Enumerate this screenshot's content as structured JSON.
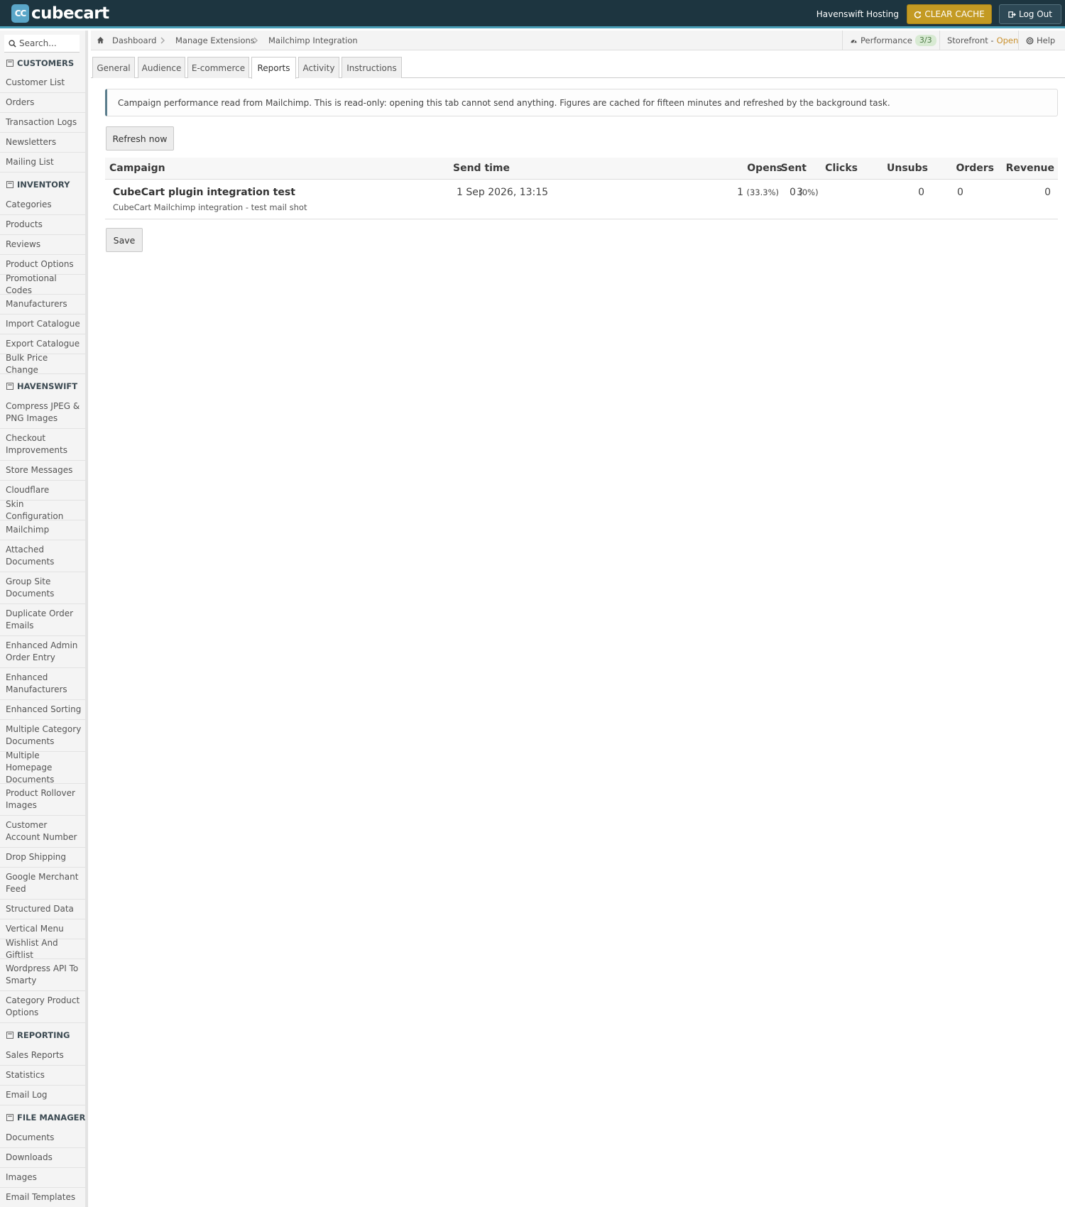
{
  "brand": {
    "badge": "CC",
    "name": "cubecart"
  },
  "header": {
    "store_name": "Havenswift Hosting",
    "clear_cache_label": "CLEAR CACHE",
    "logout_label": "Log Out"
  },
  "sidebar": {
    "search_placeholder": "Search...",
    "sections": [
      {
        "title": "CUSTOMERS",
        "items": [
          "Customer List",
          "Orders",
          "Transaction Logs",
          "Newsletters",
          "Mailing List"
        ]
      },
      {
        "title": "INVENTORY",
        "items": [
          "Categories",
          "Products",
          "Reviews",
          "Product Options",
          "Promotional Codes",
          "Manufacturers",
          "Import Catalogue",
          "Export Catalogue",
          "Bulk Price Change"
        ]
      },
      {
        "title": "HAVENSWIFT",
        "items": [
          "Compress JPEG & PNG Images",
          "Checkout Improvements",
          "Store Messages",
          "Cloudflare",
          "Skin Configuration",
          "Mailchimp",
          "Attached Documents",
          "Group Site Documents",
          "Duplicate Order Emails",
          "Enhanced Admin Order Entry",
          "Enhanced Manufacturers",
          "Enhanced Sorting",
          "Multiple Category Documents",
          "Multiple Homepage Documents",
          "Product Rollover Images",
          "Customer Account Number",
          "Drop Shipping",
          "Google Merchant Feed",
          "Structured Data",
          "Vertical Menu",
          "Wishlist And Giftlist",
          "Wordpress API To Smarty",
          "Category Product Options"
        ]
      },
      {
        "title": "REPORTING",
        "items": [
          "Sales Reports",
          "Statistics",
          "Email Log"
        ]
      },
      {
        "title": "FILE MANAGER",
        "items": [
          "Documents",
          "Downloads",
          "Images",
          "Email Templates"
        ]
      }
    ]
  },
  "breadcrumb": [
    "Dashboard",
    "Manage Extensions",
    "Mailchimp Integration"
  ],
  "topright": {
    "performance_label": "Performance",
    "performance_badge": "3/3",
    "storefront_label": "Storefront - ",
    "storefront_status": "Open",
    "help_label": "Help"
  },
  "tabs": [
    {
      "label": "General",
      "active": false
    },
    {
      "label": "Audience",
      "active": false
    },
    {
      "label": "E-commerce",
      "active": false
    },
    {
      "label": "Reports",
      "active": true
    },
    {
      "label": "Activity",
      "active": false
    },
    {
      "label": "Instructions",
      "active": false
    }
  ],
  "reports": {
    "notice": "Campaign performance read from Mailchimp. This is read-only: opening this tab cannot send anything. Figures are cached for fifteen minutes and refreshed by the background task.",
    "refresh_label": "Refresh now",
    "save_label": "Save",
    "columns": {
      "campaign": "Campaign",
      "send_time": "Send time",
      "sent": "Sent",
      "opens": "Opens",
      "clicks": "Clicks",
      "unsubs": "Unsubs",
      "orders": "Orders",
      "revenue": "Revenue"
    },
    "rows": [
      {
        "title": "CubeCart plugin integration test",
        "subtitle": "CubeCart Mailchimp integration - test mail shot",
        "send_time": "1 Sep 2026, 13:15",
        "sent": "3",
        "opens": "1",
        "opens_pct": "(33.3%)",
        "clicks": "0",
        "clicks_pct": "(0%)",
        "unsubs": "0",
        "orders": "0",
        "revenue": "0"
      }
    ]
  }
}
